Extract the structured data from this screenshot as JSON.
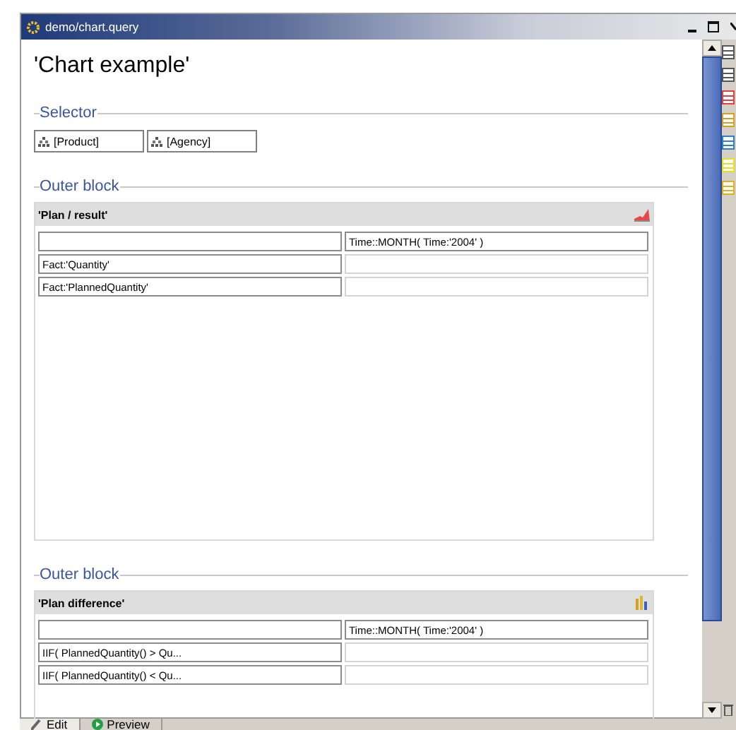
{
  "window": {
    "title": "demo/chart.query"
  },
  "heading": "'Chart example'",
  "selector": {
    "legend": "Selector",
    "items": [
      "[Product]",
      "[Agency]"
    ]
  },
  "blocks": [
    {
      "legend": "Outer block",
      "title": "'Plan / result'",
      "kind": "area",
      "column_header": "Time::MONTH( Time:'2004' )",
      "rows": [
        "Fact:'Quantity'",
        "Fact:'PlannedQuantity'"
      ]
    },
    {
      "legend": "Outer block",
      "title": "'Plan difference'",
      "kind": "bar",
      "column_header": "Time::MONTH( Time:'2004' )",
      "rows": [
        "IIF( PlannedQuantity() > Qu...",
        "IIF( PlannedQuantity() < Qu..."
      ]
    }
  ],
  "tabs": [
    {
      "label": "Edit",
      "selected": true
    },
    {
      "label": "Preview",
      "selected": false
    }
  ]
}
